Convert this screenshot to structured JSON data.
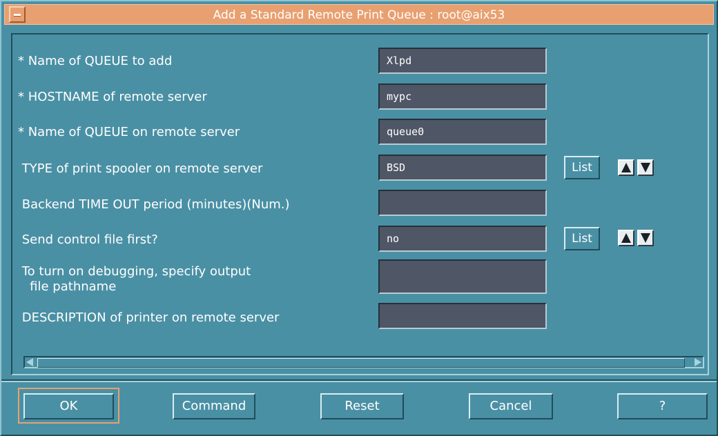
{
  "window": {
    "title": "Add a Standard Remote Print Queue : root@aix53"
  },
  "fields": [
    {
      "label": "* Name of QUEUE to add",
      "value": "Xlpd"
    },
    {
      "label": "* HOSTNAME of remote server",
      "value": "mypc"
    },
    {
      "label": "* Name of QUEUE on remote server",
      "value": "queue0"
    },
    {
      "label": " TYPE of print spooler on remote server",
      "value": "BSD",
      "list": "List"
    },
    {
      "label": " Backend TIME OUT period (minutes)(Num.)",
      "value": ""
    },
    {
      "label": " Send control file first?",
      "value": "no",
      "list": "List"
    },
    {
      "label": " To turn on debugging, specify output\n   file pathname",
      "value": ""
    },
    {
      "label": " DESCRIPTION of printer on remote server",
      "value": ""
    }
  ],
  "buttons": {
    "ok": "OK",
    "command": "Command",
    "reset": "Reset",
    "cancel": "Cancel",
    "help": "?"
  },
  "icons": {
    "window_menu": "window-menu-icon",
    "arrow_up": "arrow-up-icon",
    "arrow_down": "arrow-down-icon"
  },
  "colors": {
    "background": "#4a90a4",
    "titlebar": "#e8a070",
    "field": "#4f5666"
  }
}
